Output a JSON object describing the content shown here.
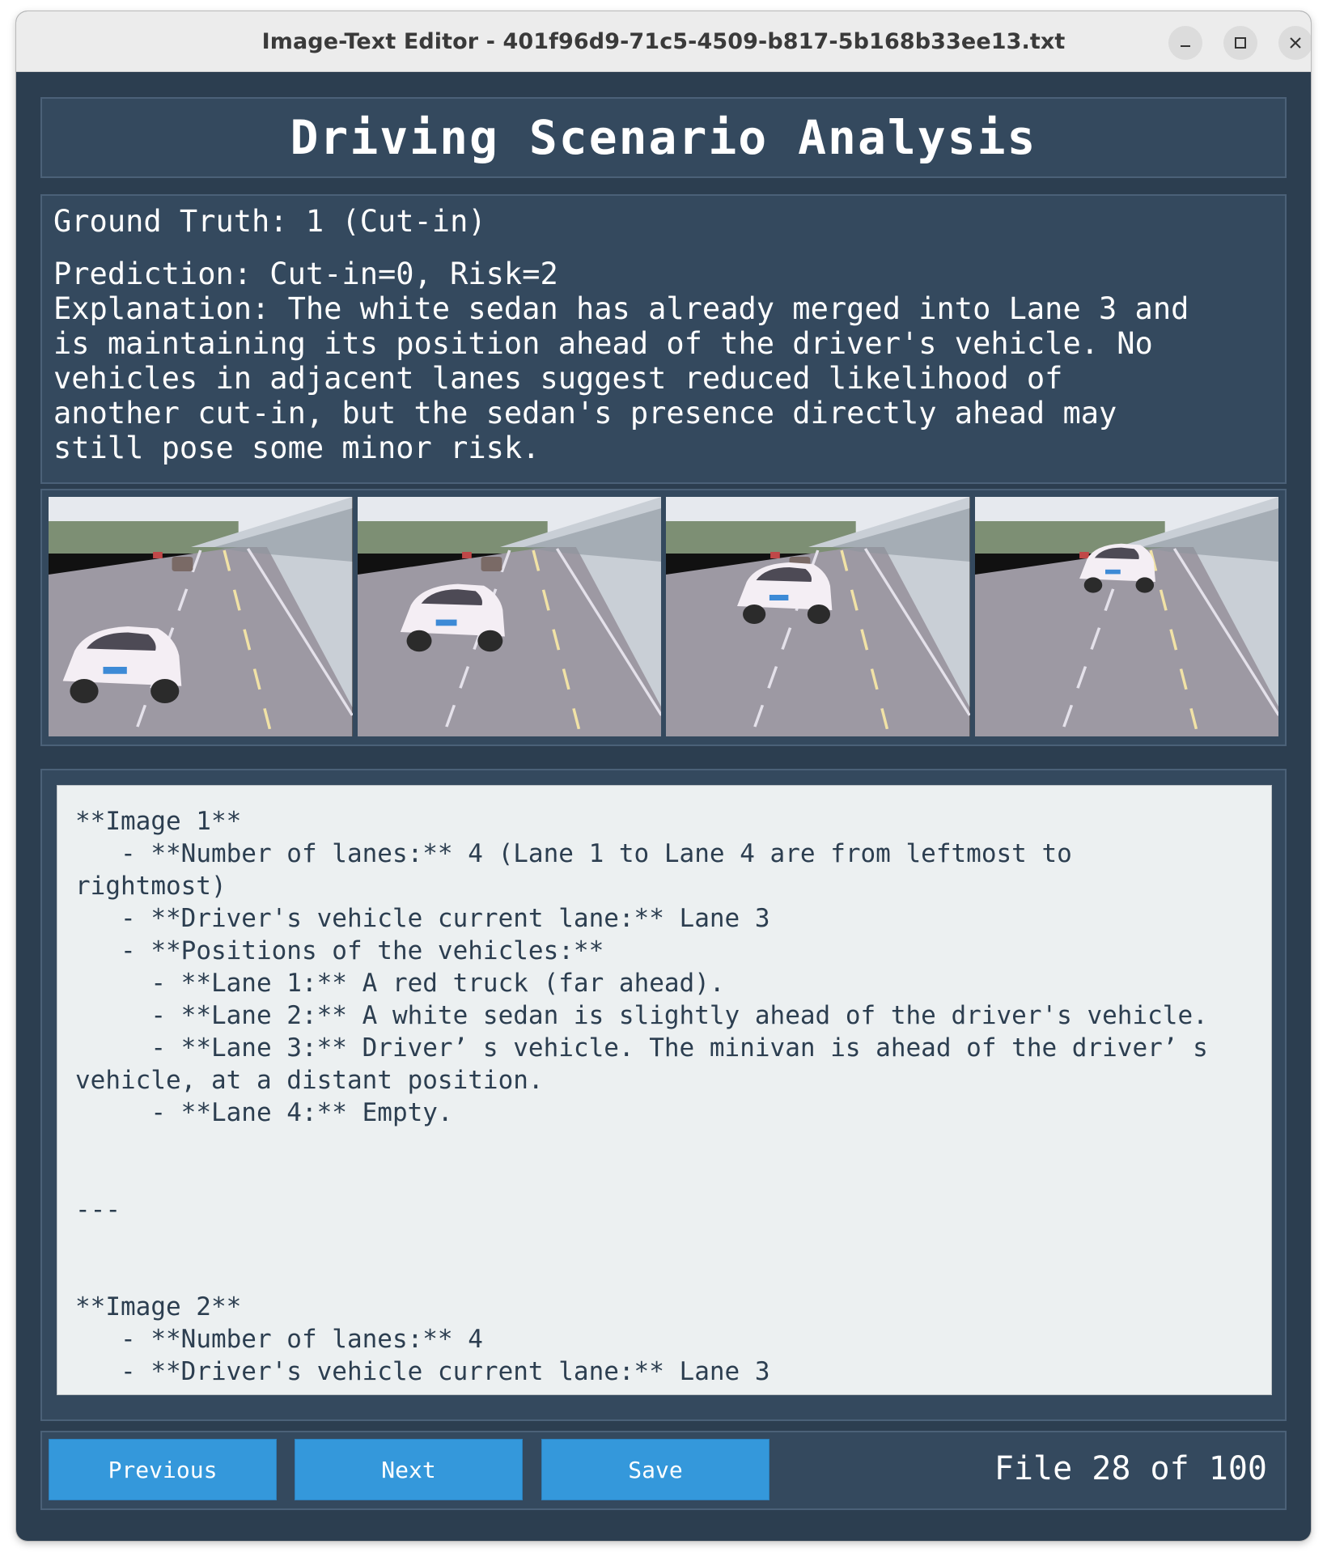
{
  "window": {
    "title": "Image-Text Editor - 401f96d9-71c5-4509-b817-5b168b33ee13.txt"
  },
  "header": {
    "title": "Driving Scenario Analysis"
  },
  "info": {
    "ground_truth": "Ground Truth: 1 (Cut-in)",
    "prediction": "Prediction: Cut-in=0, Risk=2",
    "explanation": "Explanation: The white sedan has already merged into Lane 3 and\nis maintaining its position ahead of the driver's vehicle. No\nvehicles in adjacent lanes suggest reduced likelihood of\nanother cut-in, but the sedan's presence directly ahead may\nstill pose some minor risk."
  },
  "frames": [
    {
      "name": "frame-1"
    },
    {
      "name": "frame-2"
    },
    {
      "name": "frame-3"
    },
    {
      "name": "frame-4"
    }
  ],
  "editor": {
    "content": "**Image 1**\n   - **Number of lanes:** 4 (Lane 1 to Lane 4 are from leftmost to\nrightmost)\n   - **Driver's vehicle current lane:** Lane 3\n   - **Positions of the vehicles:**\n     - **Lane 1:** A red truck (far ahead).\n     - **Lane 2:** A white sedan is slightly ahead of the driver's vehicle.\n     - **Lane 3:** Driver’ s vehicle. The minivan is ahead of the driver’ s\nvehicle, at a distant position.\n     - **Lane 4:** Empty.\n\n\n---\n\n\n**Image 2**\n   - **Number of lanes:** 4\n   - **Driver's vehicle current lane:** Lane 3"
  },
  "footer": {
    "previous_label": "Previous",
    "next_label": "Next",
    "save_label": "Save",
    "file_label": "File 28 of 100"
  },
  "colors": {
    "background": "#2c3e50",
    "panel": "#34495e",
    "button": "#3498db",
    "editor_bg": "#ecf0f1"
  }
}
